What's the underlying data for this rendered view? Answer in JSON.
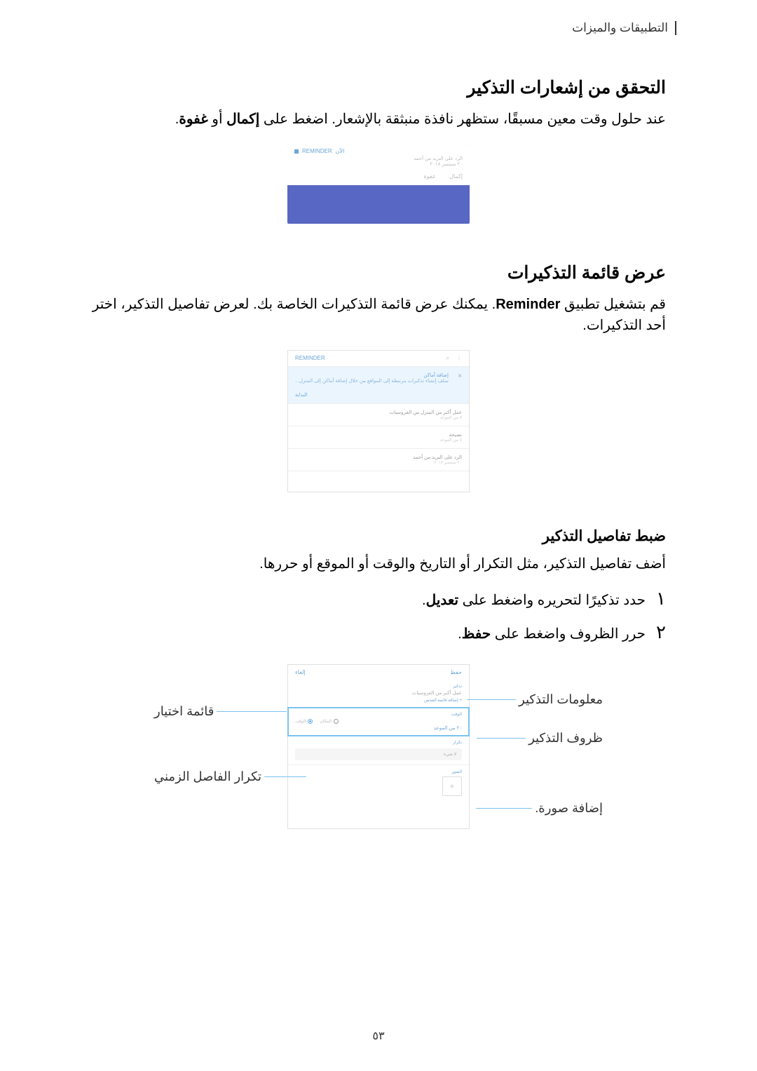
{
  "header": "التطبيقات والميزات",
  "section1": {
    "title": "التحقق من إشعارات التذكير",
    "body_prefix": "عند حلول وقت معين مسبقًا، ستظهر نافذة منبثقة بالإشعار. اضغط على ",
    "bold1": "إكمال",
    "mid": " أو ",
    "bold2": "غفوة",
    "suffix": "."
  },
  "notif": {
    "app": "REMINDER",
    "time_hint": "الآن",
    "content": "الرد على البريد من أحمد",
    "sub": "٢٠ سبتمبر ٢٠١٨",
    "action1": "غفوة",
    "action2": "إكمال"
  },
  "section2": {
    "title": "عرض قائمة التذكيرات",
    "body_prefix": "قم بتشغيل تطبيق ",
    "bold1": "Reminder",
    "suffix": ". يمكنك عرض قائمة التذكيرات الخاصة بك. لعرض تفاصيل التذكير، اختر أحد التذكيرات."
  },
  "list": {
    "title": "REMINDER",
    "banner_title": "إضافة أماكن",
    "banner_text": "سلف إنشاء تذكيرات مرتبطة إلى المواقع من خلال إضافة أماكن إلى المنزل...",
    "start": "البداية",
    "item1": "عمل أكبر من المنزل من الفروسيات",
    "item1_sub": "لا من الموعد",
    "item2": "نصيحة",
    "item2_sub": "لا من الموعد",
    "item3": "الرد على البريد من أحمد",
    "item3_sub": "٢٠ سبتمبر ٢٠١٨"
  },
  "section3": {
    "subtitle": "ضبط تفاصيل التذكير",
    "body": "أضف تفاصيل التذكير، مثل التكرار أو التاريخ والوقت أو الموقع أو حررها.",
    "step1_prefix": "حدد تذكيرًا لتحريره واضغط على ",
    "step1_bold": "تعديل",
    "step1_suffix": ".",
    "step2_prefix": "حرر الظروف واضغط على ",
    "step2_bold": "حفظ",
    "step2_suffix": "."
  },
  "step_numbers": {
    "n1": "١",
    "n2": "٢"
  },
  "edit": {
    "cancel": "إلغاء",
    "save": "حفظ",
    "title_label": "تذكير",
    "title_val": "عمل أكبر من الفروسيات",
    "memo_hint": "+ إضافة قائمة الفحص",
    "time_label": "الوقت",
    "radio_time": "الوقت",
    "radio_place": "المكان",
    "time_val": "٢٠ من الموعد",
    "repeat_label": "تكرار",
    "repeat_val": "لا شيء",
    "image_label": "الصور"
  },
  "callouts": {
    "info": "معلومات التذكير",
    "conditions": "ظروف التذكير",
    "add_image": "إضافة صورة.",
    "checklist": "قائمة اختيار",
    "interval": "تكرار الفاصل الزمني"
  },
  "page_number": "٥٣"
}
